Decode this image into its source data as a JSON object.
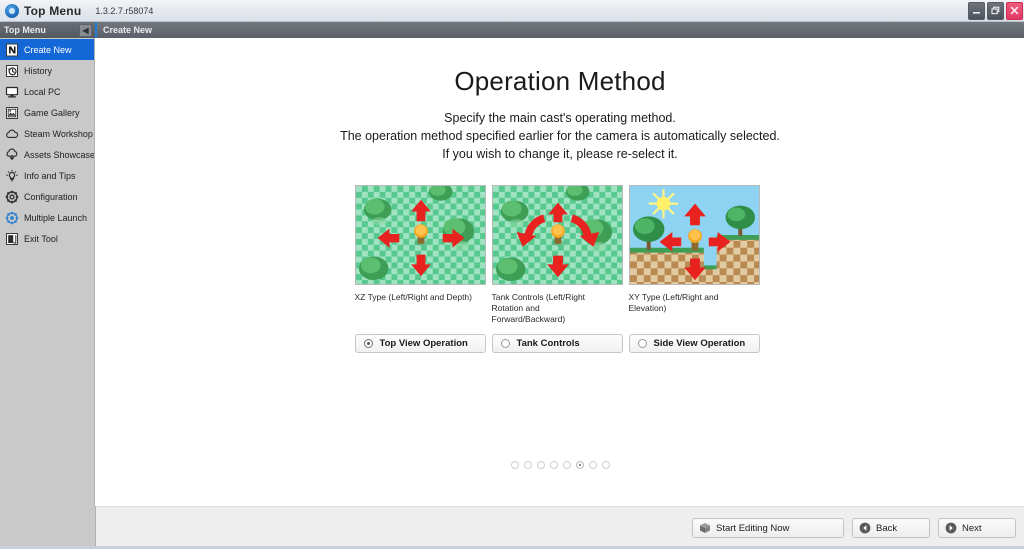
{
  "window": {
    "app_icon": "app-globe-icon",
    "title": "Top Menu",
    "version": "1.3.2.7.r58074",
    "minimize_label": "minimize-icon",
    "restore_label": "restore-icon",
    "close_label": "close-icon"
  },
  "menustrip": {
    "left_label": "Top Menu",
    "collapse_icon": "chevron-left-icon",
    "tab_label": "Create New"
  },
  "sidebar": {
    "items": [
      {
        "label": "Create New",
        "icon": "new-document-icon",
        "active": true
      },
      {
        "label": "History",
        "icon": "history-clock-icon",
        "active": false
      },
      {
        "label": "Local PC",
        "icon": "monitor-icon",
        "active": false
      },
      {
        "label": "Game Gallery",
        "icon": "gallery-image-icon",
        "active": false
      },
      {
        "label": "Steam Workshop",
        "icon": "cloud-icon",
        "active": false
      },
      {
        "label": "Assets Showcase",
        "icon": "assets-download-icon",
        "active": false
      },
      {
        "label": "Info and Tips",
        "icon": "lightbulb-icon",
        "active": false
      },
      {
        "label": "Configuration",
        "icon": "gear-icon",
        "active": false
      },
      {
        "label": "Multiple Launch",
        "icon": "multi-launch-icon",
        "active": false
      },
      {
        "label": "Exit Tool",
        "icon": "exit-door-icon",
        "active": false
      }
    ]
  },
  "main": {
    "title": "Operation Method",
    "description_line1": "Specify the main cast's operating method.",
    "description_line2": "The operation method specified earlier for the camera is automatically selected.",
    "description_line3": "If you wish to change it, please re-select it.",
    "options": [
      {
        "caption": "XZ Type (Left/Right and Depth)",
        "radio_label": "Top View Operation",
        "selected": true,
        "preview": "top-view-checkerboard-preview"
      },
      {
        "caption": "Tank Controls (Left/Right Rotation and Forward/Backward)",
        "radio_label": "Tank Controls",
        "selected": false,
        "preview": "tank-controls-checkerboard-preview"
      },
      {
        "caption": "XY Type (Left/Right and Elevation)",
        "radio_label": "Side View Operation",
        "selected": false,
        "preview": "side-view-platformer-preview"
      }
    ],
    "pager": {
      "total": 8,
      "active_index": 6
    }
  },
  "footer": {
    "start_editing_label": "Start Editing Now",
    "start_editing_icon": "cube-icon",
    "back_label": "Back",
    "back_icon": "arrow-left-circle-icon",
    "next_label": "Next",
    "next_icon": "arrow-right-circle-icon"
  },
  "colors": {
    "accent_blue": "#1367d6",
    "sidebar_gray": "#c9c9c9",
    "menu_gray": "#5b6068",
    "close_pink": "#e23a64",
    "arrow_red": "#e8231f"
  }
}
